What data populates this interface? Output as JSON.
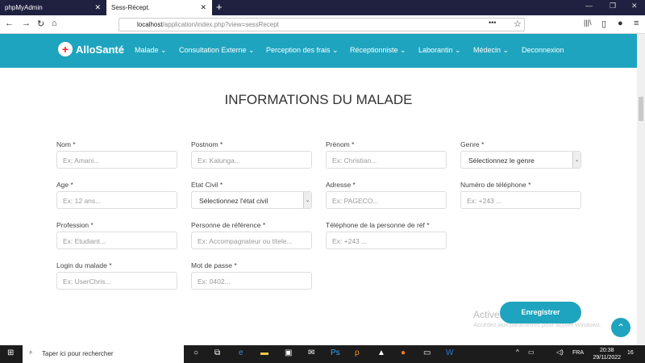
{
  "browser": {
    "tabs": [
      {
        "label": "phpMyAdmin"
      },
      {
        "label": "Sess-Récept."
      }
    ],
    "url_host": "localhost",
    "url_path": "/application/index.php?view=sessRecept"
  },
  "nav": {
    "logo": "AlloSanté",
    "items": [
      "Malade ⌄",
      "Consultation Externe ⌄",
      "Perception des frais ⌄",
      "Réceptionniste ⌄",
      "Laborantin ⌄",
      "Médecin ⌄",
      "Deconnexion"
    ]
  },
  "page": {
    "title": "INFORMATIONS DU MALADE",
    "fields": [
      {
        "label": "Nom *",
        "placeholder": "Ex: Amani..."
      },
      {
        "label": "Postnom *",
        "placeholder": "Ex: Kalunga..."
      },
      {
        "label": "Prénom *",
        "placeholder": "Ex: Christian..."
      },
      {
        "label": "Genre *",
        "value": "Sélectionnez le genre"
      },
      {
        "label": "Age *",
        "placeholder": "Ex: 12 ans..."
      },
      {
        "label": "Etat Civil *",
        "value": "Sélectionnez l'état civil"
      },
      {
        "label": "Adresse *",
        "placeholder": "Ex: PAGECO..."
      },
      {
        "label": "Numéro de téléphone *",
        "placeholder": "Ex: +243 ..."
      },
      {
        "label": "Profession *",
        "placeholder": "Ex: Etudiant..."
      },
      {
        "label": "Personne de référence *",
        "placeholder": "Ex: Accompagnateur ou titele..."
      },
      {
        "label": "Téléphone de la personne de réf *",
        "placeholder": "Ex: +243 ..."
      },
      {
        "label": "Login du malade *",
        "placeholder": "Ex: UserChris..."
      },
      {
        "label": "Mot de passe *",
        "placeholder": "Ex: 0402..."
      }
    ],
    "submit": "Enregistrer",
    "watermark": "Activer Windows",
    "watermark_sub": "Accédez aux paramètres pour activer Windows."
  },
  "taskbar": {
    "search": "Taper ici pour rechercher",
    "lang": "FRA",
    "time": "20:38",
    "date": "29/11/2022",
    "notifications": "16"
  }
}
